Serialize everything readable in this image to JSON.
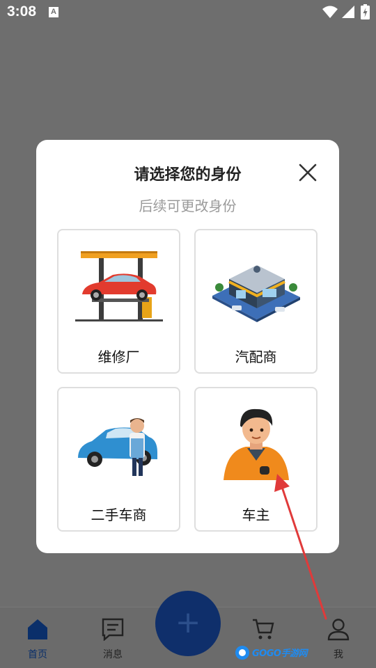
{
  "status_bar": {
    "time": "3:08",
    "notification_icon_letter": "A",
    "icons": [
      "wifi-icon",
      "signal-icon",
      "battery-charging-icon"
    ]
  },
  "modal": {
    "title": "请选择您的身份",
    "subtitle": "后续可更改身份",
    "close_icon": "close-icon",
    "options": [
      {
        "label": "维修厂",
        "icon": "car-lift-image"
      },
      {
        "label": "汽配商",
        "icon": "auto-parts-store-image"
      },
      {
        "label": "二手车商",
        "icon": "used-car-dealer-image"
      },
      {
        "label": "车主",
        "icon": "car-owner-image"
      }
    ]
  },
  "bottom_nav": {
    "items": [
      {
        "label": "首页",
        "icon": "home-icon",
        "active": true
      },
      {
        "label": "消息",
        "icon": "message-icon",
        "active": false
      },
      {
        "label": "",
        "icon": "cart-icon",
        "active": false
      },
      {
        "label": "我",
        "icon": "user-icon",
        "active": false
      }
    ],
    "fab_icon": "plus-icon"
  },
  "watermark": {
    "text": "GOGO手游网"
  },
  "colors": {
    "overlay": "#6e6e6e",
    "fab": "#0f2f6b",
    "active_nav": "#0a2f6a",
    "annotation_arrow": "#e03a3a"
  }
}
